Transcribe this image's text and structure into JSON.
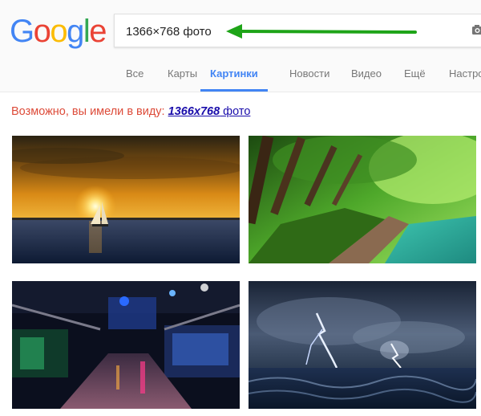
{
  "logo": {
    "letters": [
      "G",
      "o",
      "o",
      "g",
      "l",
      "e"
    ]
  },
  "search": {
    "query": "1366×768 фото"
  },
  "tabs": [
    {
      "label": "Все",
      "active": false
    },
    {
      "label": "Карты",
      "active": false
    },
    {
      "label": "Картинки",
      "active": true
    },
    {
      "label": "Новости",
      "active": false
    },
    {
      "label": "Видео",
      "active": false
    },
    {
      "label": "Ещё",
      "active": false
    },
    {
      "label": "Настройки",
      "active": false
    }
  ],
  "suggestion": {
    "prefix": "Возможно, вы имели в виду: ",
    "link_bold": "1366x768",
    "link_rest": " фото"
  },
  "colors": {
    "accent_blue": "#4285f4",
    "suggestion_red": "#dd4b39",
    "link_blue": "#1a0dab",
    "arrow_green": "#1ea418"
  },
  "icons": {
    "arrow": "green-arrow-icon",
    "camera": "camera-icon"
  },
  "images": [
    {
      "subject": "sunset-sailboat"
    },
    {
      "subject": "forest-river"
    },
    {
      "subject": "neon-aquarium-hall"
    },
    {
      "subject": "lightning-storm-sea"
    }
  ]
}
